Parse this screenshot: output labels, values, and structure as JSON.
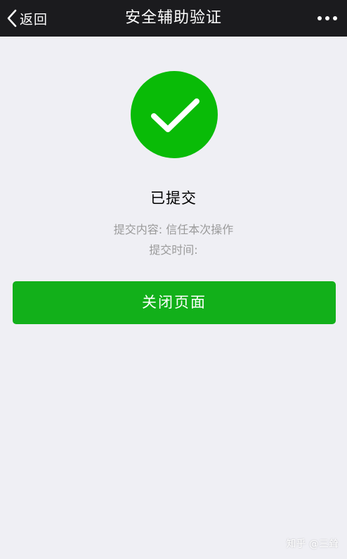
{
  "navbar": {
    "back_label": "返回",
    "title": "安全辅助验证",
    "more_icon": "more-dots-icon"
  },
  "result": {
    "icon": "checkmark-icon",
    "icon_color": "#09bb07",
    "title": "已提交",
    "content_line": "提交内容: 信任本次操作",
    "time_line": "提交时间:"
  },
  "actions": {
    "close_label": "关闭页面",
    "close_color": "#12b01a"
  },
  "watermark": {
    "text": "知乎 @三耸"
  }
}
